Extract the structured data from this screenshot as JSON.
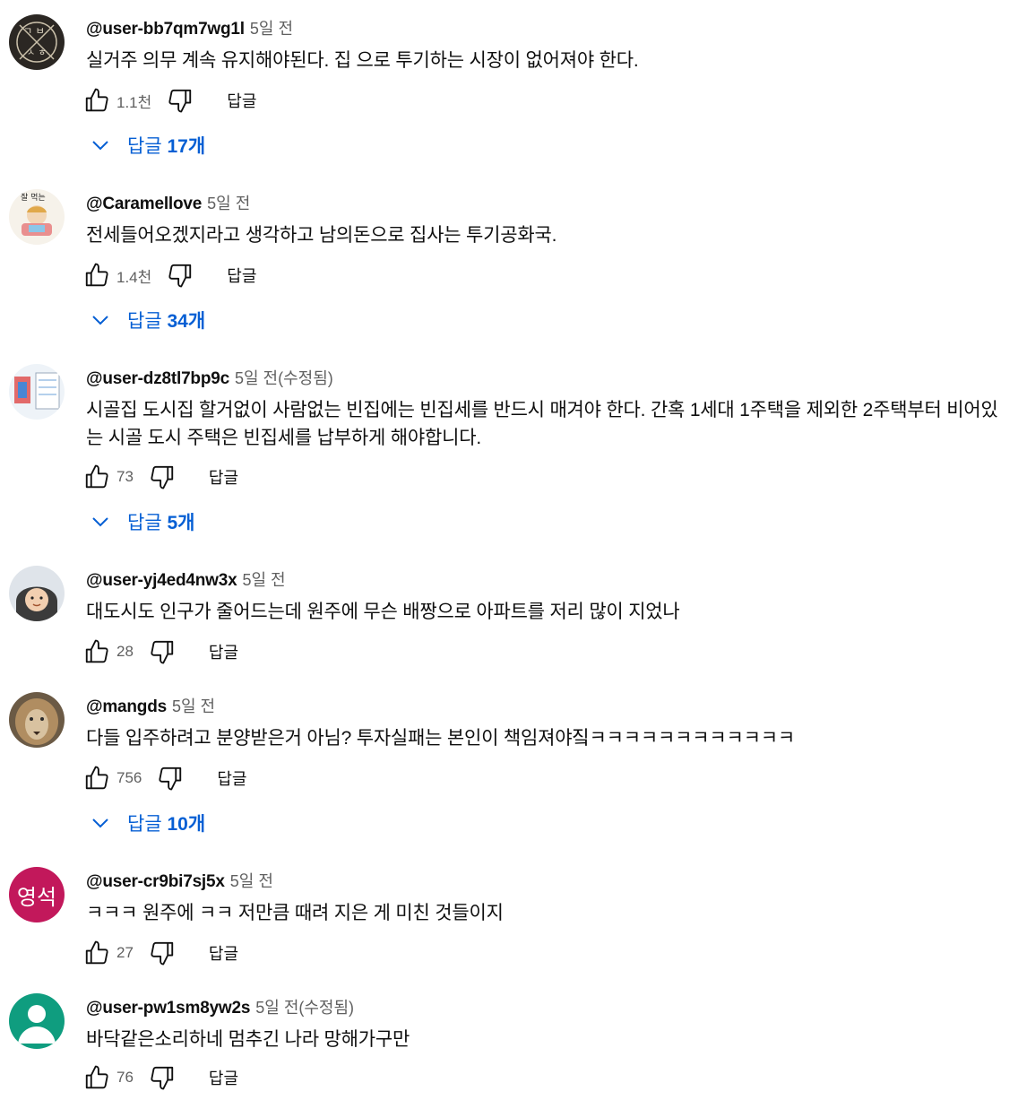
{
  "reply_label": "답글",
  "replies_prefix": "답글",
  "comments": [
    {
      "author": "@user-bb7qm7wg1l",
      "time": "5일 전",
      "text": "실거주 의무 계속 유지해야된다. 집 으로 투기하는 시장이 없어져야 한다.",
      "likes": "1.1천",
      "replies_count": "17개"
    },
    {
      "author": "@Caramellove",
      "time": "5일 전",
      "text": "전세들어오겠지라고 생각하고 남의돈으로 집사는 투기공화국.",
      "likes": "1.4천",
      "replies_count": "34개"
    },
    {
      "author": "@user-dz8tl7bp9c",
      "time": "5일 전(수정됨)",
      "text": "시골집 도시집 할거없이 사람없는 빈집에는 빈집세를 반드시 매겨야 한다. 간혹 1세대 1주택을 제외한 2주택부터 비어있는 시골 도시 주택은 빈집세를 납부하게 해야합니다.",
      "likes": "73",
      "replies_count": "5개"
    },
    {
      "author": "@user-yj4ed4nw3x",
      "time": "5일 전",
      "text": "대도시도 인구가 줄어드는데 원주에 무슨 배짱으로 아파트를 저리 많이 지었나",
      "likes": "28"
    },
    {
      "author": "@mangds",
      "time": "5일 전",
      "text": "다들 입주하려고 분양받은거 아님? 투자실패는 본인이 책임져야짘ㅋㅋㅋㅋㅋㅋㅋㅋㅋㅋㅋㅋ",
      "likes": "756",
      "replies_count": "10개"
    },
    {
      "author": "@user-cr9bi7sj5x",
      "time": "5일 전",
      "text": "ㅋㅋㅋ 원주에 ㅋㅋ 저만큼 때려 지은 게 미친 것들이지",
      "likes": "27",
      "avatar_text": "영석"
    },
    {
      "author": "@user-pw1sm8yw2s",
      "time": "5일 전(수정됨)",
      "text": "바닥같은소리하네 멈추긴 나라 망해가구만",
      "likes": "76"
    }
  ],
  "colors": {
    "link": "#065fd4",
    "meta": "#606060",
    "avatar_pink": "#c2185b",
    "avatar_teal": "#0f9d7f"
  }
}
